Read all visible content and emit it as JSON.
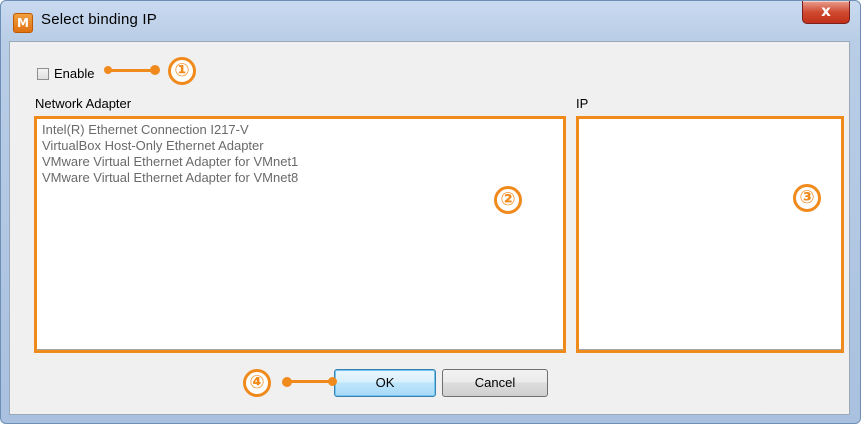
{
  "window": {
    "title": "Select binding IP",
    "app_icon_letter": "M",
    "close_symbol": "x"
  },
  "enable": {
    "label": "Enable",
    "checked": false
  },
  "network_adapter": {
    "label": "Network Adapter",
    "items": [
      "Intel(R) Ethernet Connection I217-V",
      "VirtualBox Host-Only Ethernet Adapter",
      "VMware Virtual Ethernet Adapter for VMnet1",
      "VMware Virtual Ethernet Adapter for VMnet8"
    ]
  },
  "ip": {
    "label": "IP",
    "items": []
  },
  "buttons": {
    "ok": "OK",
    "cancel": "Cancel"
  },
  "callouts": [
    "①",
    "②",
    "③",
    "④"
  ],
  "colors": {
    "highlight": "#f08a1c",
    "title_bar": "#b9cde6",
    "close_button": "#c03018"
  }
}
